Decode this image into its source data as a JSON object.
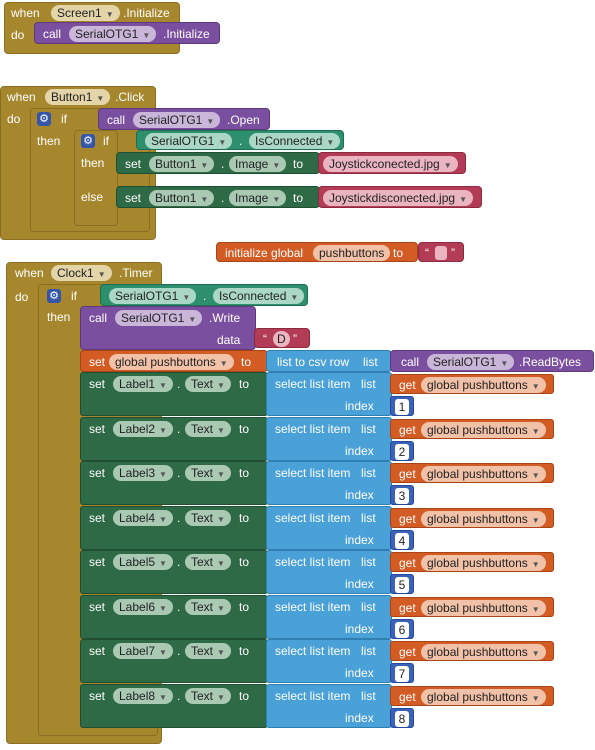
{
  "screen_init": {
    "when": "when",
    "component": "Screen1",
    "event": ".Initialize",
    "do": "do",
    "call": "call",
    "proc_comp": "SerialOTG1",
    "proc": ".Initialize"
  },
  "button_click": {
    "when": "when",
    "component": "Button1",
    "event": ".Click",
    "do": "do",
    "if": "if",
    "call": "call",
    "open_comp": "SerialOTG1",
    "open": ".Open",
    "then": "then",
    "if2": "if",
    "conn_comp": "SerialOTG1",
    "dot": ".",
    "conn": "IsConnected",
    "then2": "then",
    "else": "else",
    "set": "set",
    "btn": "Button1",
    "image": "Image",
    "to": "to",
    "img_connected": "Joystickconected.jpg",
    "img_disconnected": "Joystickdisconected.jpg"
  },
  "init_global": {
    "label": "initialize global",
    "name": "pushbuttons",
    "to": "to"
  },
  "clock_timer": {
    "when": "when",
    "component": "Clock1",
    "event": ".Timer",
    "do": "do",
    "if": "if",
    "conn_comp": "SerialOTG1",
    "dot": ".",
    "conn": "IsConnected",
    "then": "then",
    "call": "call",
    "write_comp": "SerialOTG1",
    "write": ".Write",
    "data": "data",
    "data_val": "D",
    "set": "set",
    "global_pb": "global pushbuttons",
    "to": "to",
    "csv": "list to csv row",
    "list": "list",
    "read_comp": "SerialOTG1",
    "read": ".ReadBytes",
    "text": "Text",
    "select": "select list item",
    "index": "index",
    "get": "get",
    "rows": [
      {
        "label": "Label1",
        "index": "1"
      },
      {
        "label": "Label2",
        "index": "2"
      },
      {
        "label": "Label3",
        "index": "3"
      },
      {
        "label": "Label4",
        "index": "4"
      },
      {
        "label": "Label5",
        "index": "5"
      },
      {
        "label": "Label6",
        "index": "6"
      },
      {
        "label": "Label7",
        "index": "7"
      },
      {
        "label": "Label8",
        "index": "8"
      }
    ]
  },
  "colors": {
    "event": "#a6872d",
    "procedure": "#7b4f9f",
    "setter": "#2f6a46",
    "logic": "#2e8f6e",
    "variable": "#d35b24",
    "text": "#b23b55",
    "list": "#4aa1d8",
    "math": "#3a63b8"
  }
}
